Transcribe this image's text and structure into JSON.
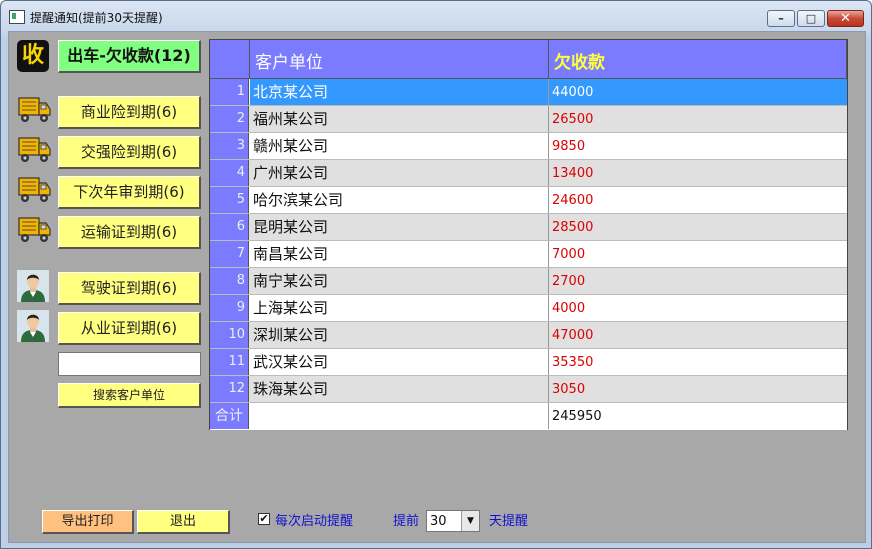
{
  "window": {
    "title": "提醒通知(提前30天提醒)"
  },
  "left_panel": {
    "shou_icon_text": "收",
    "outstanding_button": "出车-欠收款(12)",
    "buttons": [
      {
        "label": "商业险到期(6)",
        "icon": "truck-icon"
      },
      {
        "label": "交强险到期(6)",
        "icon": "truck-icon"
      },
      {
        "label": "下次年审到期(6)",
        "icon": "truck-icon"
      },
      {
        "label": "运输证到期(6)",
        "icon": "truck-icon"
      },
      {
        "label": "驾驶证到期(6)",
        "icon": "driver-icon"
      },
      {
        "label": "从业证到期(6)",
        "icon": "driver-icon"
      }
    ],
    "search_input_value": "",
    "search_button": "搜索客户单位"
  },
  "table": {
    "headers": {
      "customer": "客户单位",
      "amount": "欠收款"
    },
    "rows": [
      {
        "no": "1",
        "name": "北京某公司",
        "amount": "44000"
      },
      {
        "no": "2",
        "name": "福州某公司",
        "amount": "26500"
      },
      {
        "no": "3",
        "name": "赣州某公司",
        "amount": "9850"
      },
      {
        "no": "4",
        "name": "广州某公司",
        "amount": "13400"
      },
      {
        "no": "5",
        "name": "哈尔滨某公司",
        "amount": "24600"
      },
      {
        "no": "6",
        "name": "昆明某公司",
        "amount": "28500"
      },
      {
        "no": "7",
        "name": "南昌某公司",
        "amount": "7000"
      },
      {
        "no": "8",
        "name": "南宁某公司",
        "amount": "2700"
      },
      {
        "no": "9",
        "name": "上海某公司",
        "amount": "4000"
      },
      {
        "no": "10",
        "name": "深圳某公司",
        "amount": "47000"
      },
      {
        "no": "11",
        "name": "武汉某公司",
        "amount": "35350"
      },
      {
        "no": "12",
        "name": "珠海某公司",
        "amount": "3050"
      }
    ],
    "selected_row": 1,
    "total_label": "合计",
    "total_amount": "245950"
  },
  "bottom": {
    "export_button": "导出打印",
    "exit_button": "退出",
    "remind_checkbox_label": "每次启动提醒",
    "remind_checked": true,
    "advance_label": "提前",
    "days_value": "30",
    "days_suffix": "天提醒"
  },
  "colors": {
    "header_bg": "#7b7bff",
    "amount_red": "#dd0000",
    "selected_blue": "#3399ff",
    "yellow_button": "#ffff80",
    "green_button": "#80ff80",
    "export_button": "#ffc080"
  }
}
